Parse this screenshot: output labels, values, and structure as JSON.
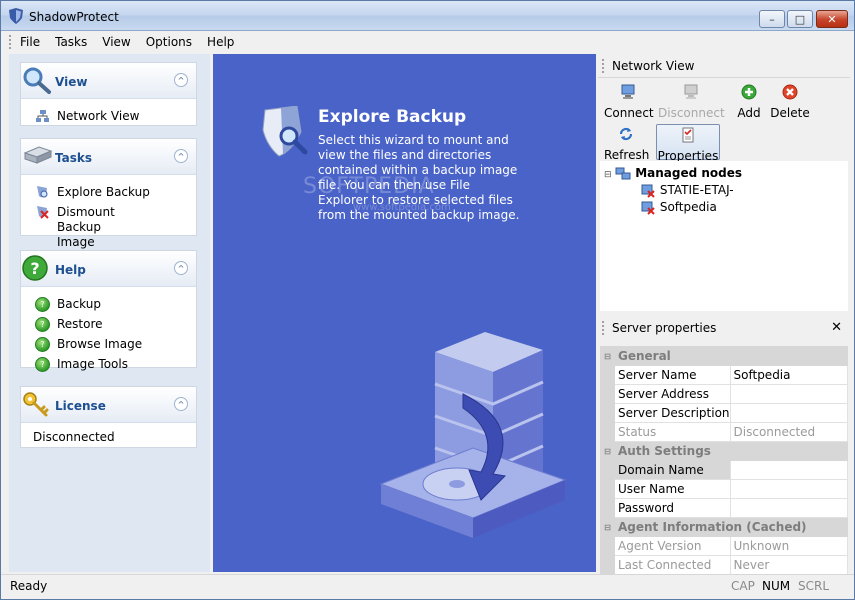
{
  "window": {
    "title": "ShadowProtect"
  },
  "menu": [
    "File",
    "Tasks",
    "View",
    "Options",
    "Help"
  ],
  "left": {
    "view": {
      "title": "View",
      "items": [
        "Network View"
      ]
    },
    "tasks": {
      "title": "Tasks",
      "items": [
        "Explore Backup",
        "Dismount Backup Image"
      ]
    },
    "help": {
      "title": "Help",
      "items": [
        "Backup",
        "Restore",
        "Browse Image",
        "Image Tools"
      ]
    },
    "license": {
      "title": "License",
      "status": "Disconnected"
    }
  },
  "center": {
    "title": "Explore Backup",
    "description": "Select this wizard to mount and view the files and directories contained within a backup image file.  You can then use File Explorer to restore selected files from the mounted backup image.",
    "watermark": "SOFTPEDIA",
    "watermark_sub": "www.softpedia.com"
  },
  "network": {
    "title": "Network View",
    "toolbar": {
      "connect": "Connect",
      "disconnect": "Disconnect",
      "add": "Add",
      "delete": "Delete",
      "refresh": "Refresh",
      "properties": "Properties"
    },
    "tree": {
      "root": "Managed nodes",
      "nodes": [
        "STATIE-ETAJ-",
        "Softpedia"
      ]
    }
  },
  "properties": {
    "title": "Server properties",
    "sections": {
      "general": "General",
      "auth": "Auth Settings",
      "agent": "Agent Information (Cached)"
    },
    "rows": {
      "server_name": {
        "key": "Server Name",
        "value": "Softpedia"
      },
      "server_address": {
        "key": "Server Address",
        "value": ""
      },
      "server_description": {
        "key": "Server Description",
        "value": ""
      },
      "status": {
        "key": "Status",
        "value": "Disconnected"
      },
      "domain_name": {
        "key": "Domain Name",
        "value": ""
      },
      "user_name": {
        "key": "User Name",
        "value": ""
      },
      "password": {
        "key": "Password",
        "value": ""
      },
      "agent_version": {
        "key": "Agent Version",
        "value": "Unknown"
      },
      "last_connected": {
        "key": "Last Connected",
        "value": "Never"
      }
    }
  },
  "status": {
    "text": "Ready",
    "cap": "CAP",
    "num": "NUM",
    "scrl": "SCRL"
  },
  "colors": {
    "center_bg": "#4a63c8",
    "accent": "#1d4f91",
    "selection": "#3366cc"
  }
}
